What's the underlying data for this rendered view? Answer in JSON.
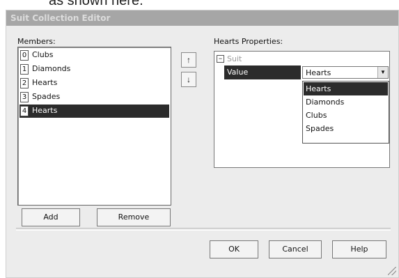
{
  "caption": {
    "text": "as shown here."
  },
  "window": {
    "title": "Suit Collection Editor"
  },
  "members": {
    "label": "Members:",
    "items": [
      {
        "index": "0",
        "name": "Clubs"
      },
      {
        "index": "1",
        "name": "Diamonds"
      },
      {
        "index": "2",
        "name": "Hearts"
      },
      {
        "index": "3",
        "name": "Spades"
      },
      {
        "index": "4",
        "name": "Hearts"
      }
    ],
    "selected_index": 4,
    "move_up_icon": "arrow-up-icon",
    "move_down_icon": "arrow-down-icon"
  },
  "properties": {
    "label": "Hearts Properties:",
    "category": {
      "toggle": "⊟",
      "name": "Suit"
    },
    "row": {
      "label": "Value",
      "value": "Hearts"
    },
    "dropdown": {
      "options": [
        "Hearts",
        "Diamonds",
        "Clubs",
        "Spades"
      ],
      "selected": "Hearts"
    }
  },
  "buttons": {
    "add": "Add",
    "remove": "Remove",
    "ok": "OK",
    "cancel": "Cancel",
    "help": "Help"
  }
}
